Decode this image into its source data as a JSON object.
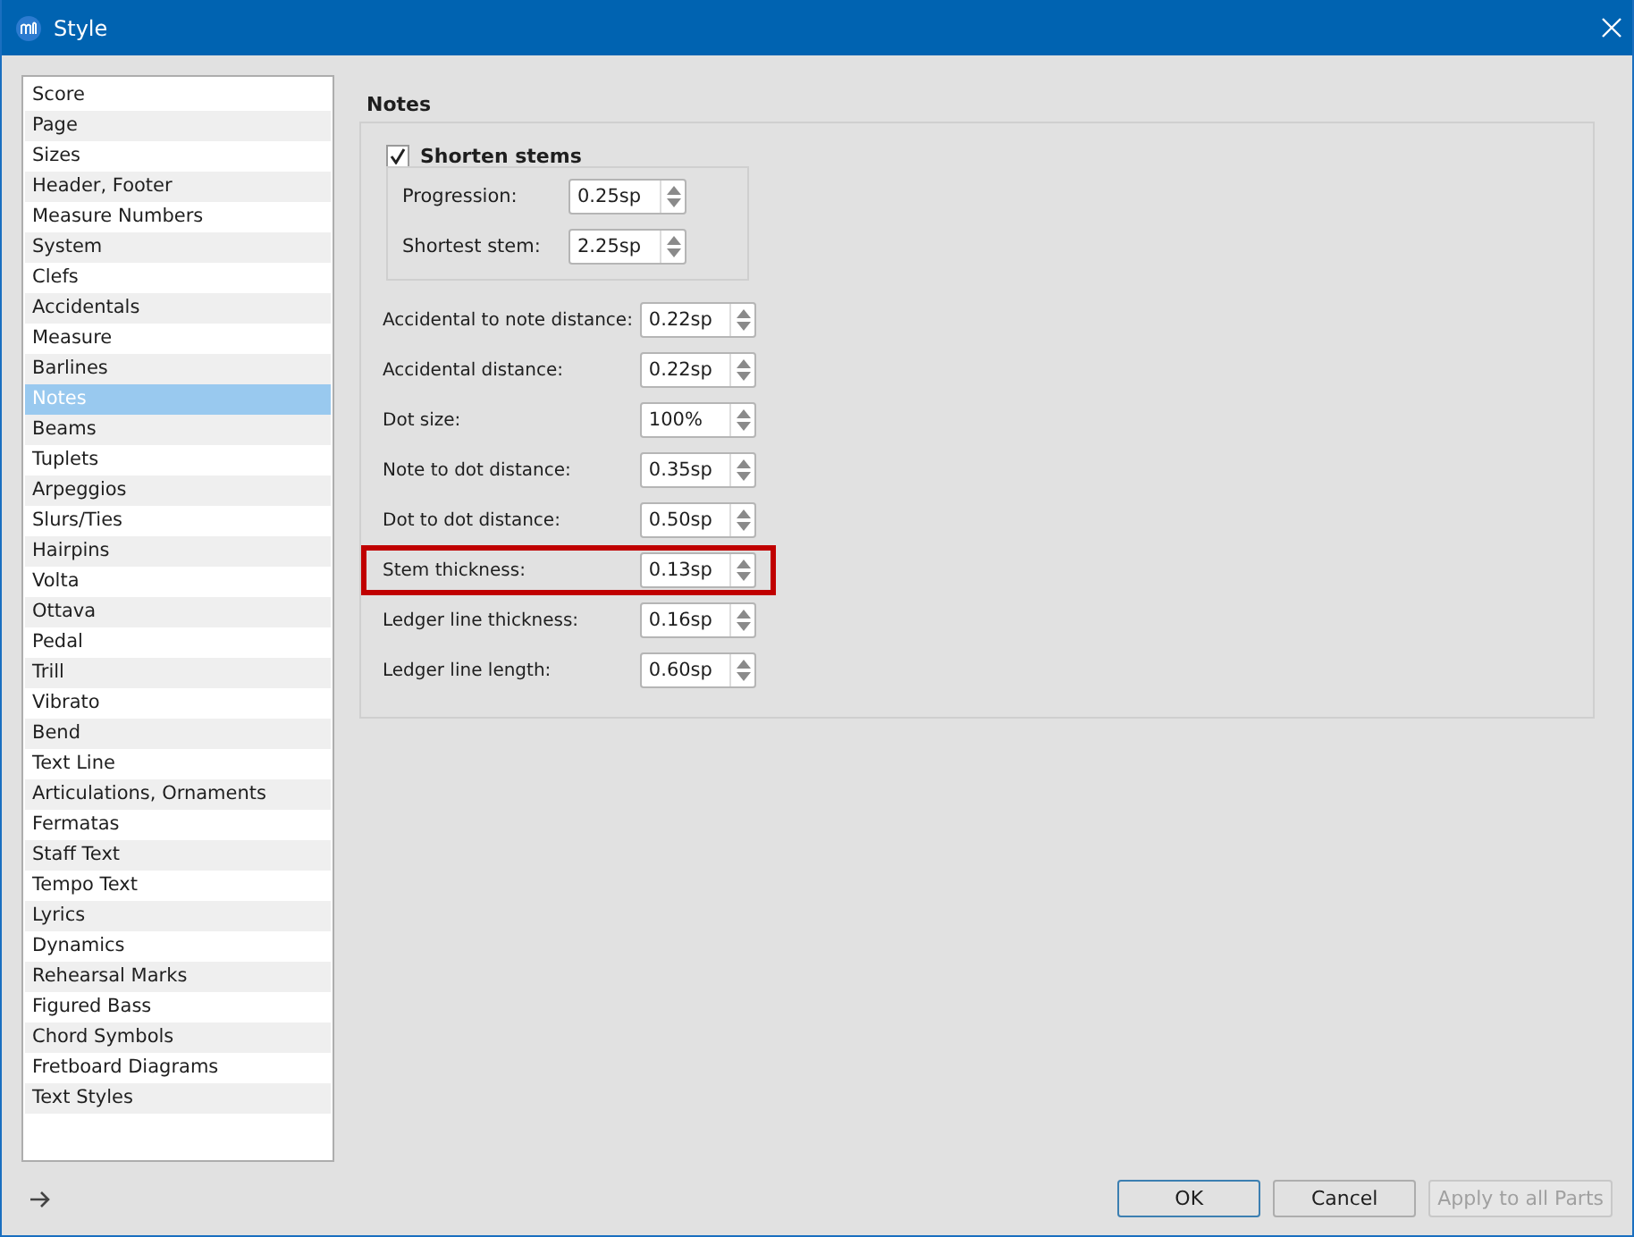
{
  "window": {
    "title": "Style"
  },
  "sidebar": {
    "items": [
      {
        "label": "Score",
        "selected": false
      },
      {
        "label": "Page",
        "selected": false
      },
      {
        "label": "Sizes",
        "selected": false
      },
      {
        "label": "Header, Footer",
        "selected": false
      },
      {
        "label": "Measure Numbers",
        "selected": false
      },
      {
        "label": "System",
        "selected": false
      },
      {
        "label": "Clefs",
        "selected": false
      },
      {
        "label": "Accidentals",
        "selected": false
      },
      {
        "label": "Measure",
        "selected": false
      },
      {
        "label": "Barlines",
        "selected": false
      },
      {
        "label": "Notes",
        "selected": true
      },
      {
        "label": "Beams",
        "selected": false
      },
      {
        "label": "Tuplets",
        "selected": false
      },
      {
        "label": "Arpeggios",
        "selected": false
      },
      {
        "label": "Slurs/Ties",
        "selected": false
      },
      {
        "label": "Hairpins",
        "selected": false
      },
      {
        "label": "Volta",
        "selected": false
      },
      {
        "label": "Ottava",
        "selected": false
      },
      {
        "label": "Pedal",
        "selected": false
      },
      {
        "label": "Trill",
        "selected": false
      },
      {
        "label": "Vibrato",
        "selected": false
      },
      {
        "label": "Bend",
        "selected": false
      },
      {
        "label": "Text Line",
        "selected": false
      },
      {
        "label": "Articulations, Ornaments",
        "selected": false
      },
      {
        "label": "Fermatas",
        "selected": false
      },
      {
        "label": "Staff Text",
        "selected": false
      },
      {
        "label": "Tempo Text",
        "selected": false
      },
      {
        "label": "Lyrics",
        "selected": false
      },
      {
        "label": "Dynamics",
        "selected": false
      },
      {
        "label": "Rehearsal Marks",
        "selected": false
      },
      {
        "label": "Figured Bass",
        "selected": false
      },
      {
        "label": "Chord Symbols",
        "selected": false
      },
      {
        "label": "Fretboard Diagrams",
        "selected": false
      },
      {
        "label": "Text Styles",
        "selected": false
      }
    ]
  },
  "group": {
    "title": "Notes",
    "shorten_stems": {
      "label": "Shorten stems",
      "checked": true,
      "fields": [
        {
          "label": "Progression:",
          "value": "0.25sp"
        },
        {
          "label": "Shortest stem:",
          "value": "2.25sp"
        }
      ]
    },
    "fields": [
      {
        "label": "Accidental to note distance:",
        "value": "0.22sp",
        "highlighted": false
      },
      {
        "label": "Accidental distance:",
        "value": "0.22sp",
        "highlighted": false
      },
      {
        "label": "Dot size:",
        "value": "100%",
        "highlighted": false
      },
      {
        "label": "Note to dot distance:",
        "value": "0.35sp",
        "highlighted": false
      },
      {
        "label": "Dot to dot distance:",
        "value": "0.50sp",
        "highlighted": false
      },
      {
        "label": "Stem thickness:",
        "value": "0.13sp",
        "highlighted": true
      },
      {
        "label": "Ledger line thickness:",
        "value": "0.16sp",
        "highlighted": false
      },
      {
        "label": "Ledger line length:",
        "value": "0.60sp",
        "highlighted": false
      }
    ]
  },
  "buttons": [
    {
      "label": "OK",
      "kind": "default",
      "disabled": false
    },
    {
      "label": "Cancel",
      "kind": "normal",
      "disabled": false
    },
    {
      "label": "Apply to all Parts",
      "kind": "normal",
      "disabled": true
    }
  ]
}
